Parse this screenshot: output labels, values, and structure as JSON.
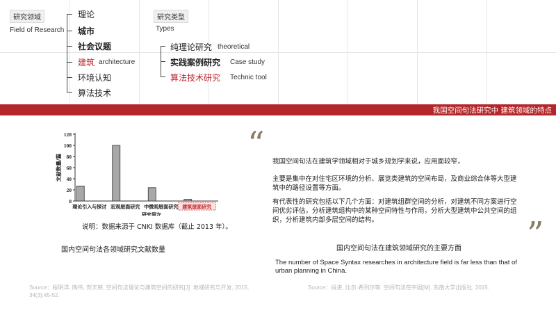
{
  "header": {
    "field_tag": "研究领域",
    "field_tag_en": "Field of Research",
    "fields": [
      {
        "label": "理论",
        "en": ""
      },
      {
        "label": "城市",
        "en": ""
      },
      {
        "label": "社会议题",
        "en": ""
      },
      {
        "label": "建筑",
        "en": "architecture"
      },
      {
        "label": "环境认知",
        "en": ""
      },
      {
        "label": "算法技术",
        "en": ""
      }
    ],
    "type_tag": "研究类型",
    "type_tag_en": "Types",
    "types": [
      {
        "label": "纯理论研究",
        "en": "theoretical"
      },
      {
        "label": "实践案例研究",
        "en": "Case study"
      },
      {
        "label": "算法技术研究",
        "en": "Technic tool"
      }
    ]
  },
  "banner": {
    "title": "我国空间句法研究中 建筑领域的特点"
  },
  "chart_data": {
    "type": "bar",
    "categories": [
      "理论引入与探讨",
      "宏观层面研究",
      "中微观层面研究",
      "建筑层面研究"
    ],
    "values": [
      27,
      100,
      24,
      3
    ],
    "highlight_index": 3,
    "ylabel": "文献数量/篇",
    "xlabel": "研究层次",
    "yticks": [
      0,
      20,
      40,
      60,
      80,
      100,
      120
    ],
    "ylim": [
      0,
      120
    ],
    "grid": false
  },
  "chart_note": "说明：数据来源于 CNKI 数据库（截止 2013 年）。",
  "left_caption": "国内空间句法各领域研究文献数量",
  "left_source": "Source：程明洋, 陶伟, 贺天慈. 空间句法理论与建筑空间的研究[J]. 地域研究与开发, 2015, 34(3):45-52.",
  "quote": {
    "open": "“",
    "close": "”",
    "paragraphs": [
      "我国空间句法在建筑学领域相对于城乡规划学来说，应用面较窄，",
      "主要是集中在对住宅区环境的分析、展览类建筑的空间布局，及商业综合体等大型建筑中的路径设置等方面。",
      "有代表性的研究包括以下几个方面：对建筑组群空间的分析，对建筑不同方案进行空间优劣评估，分析建筑组构中的某种空间特性与作用，分析大型建筑中公共空间的组织，分析建筑内部多层空间的结构。"
    ]
  },
  "right_caption": "国内空间句法在建筑领域研究的主要方面",
  "summary_en": "The number of Space Syntax researches in architecture field is far less than that of urban planning in China.",
  "right_source": "Source：段进, 比尔·希列尔等. 空间句法在中国[M]. 东南大学出版社, 2015.",
  "colors": {
    "accent_red": "#b3272b",
    "highlight_red": "#c0282d",
    "quote_mark": "#8b7d64",
    "bar_fill": "#a8a8a8"
  }
}
